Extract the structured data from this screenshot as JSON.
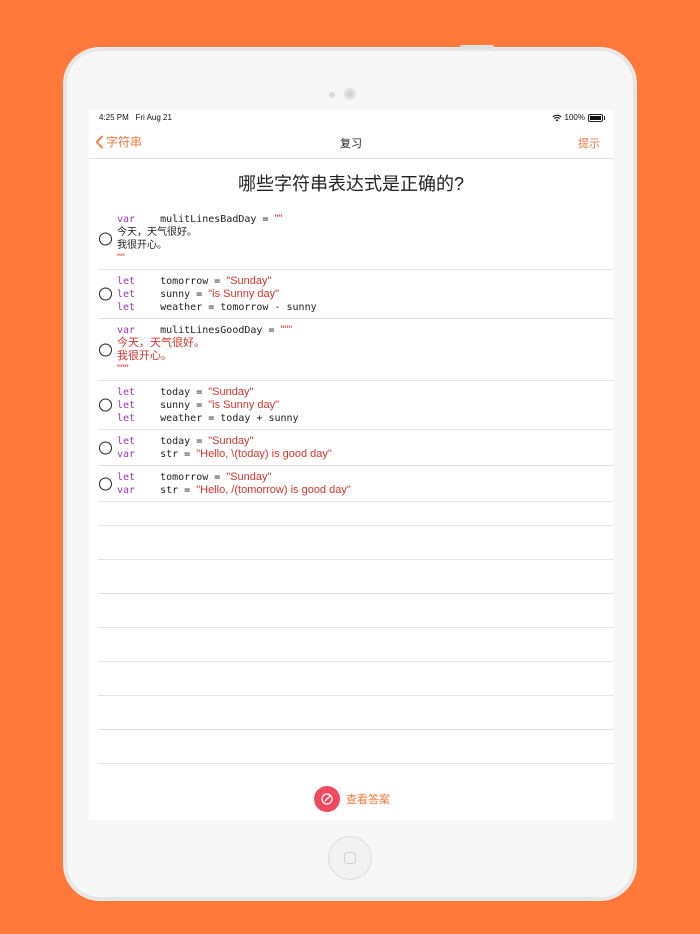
{
  "status": {
    "time": "4:25 PM",
    "date": "Fri Aug 21",
    "battery": "100%"
  },
  "nav": {
    "back_label": "字符串",
    "title": "复习",
    "hint_label": "提示"
  },
  "question": "哪些字符串表达式是正确的?",
  "options": [
    {
      "lines": [
        [
          {
            "t": "var",
            "c": "kw"
          },
          {
            "t": " mulitLinesBadDay = ",
            "c": "code"
          },
          {
            "t": "\"\"",
            "c": "str"
          }
        ],
        [
          {
            "t": "今天，天气很好。",
            "c": "plain-cn"
          }
        ],
        [
          {
            "t": "我很开心。",
            "c": "plain-cn"
          }
        ],
        [
          {
            "t": "\"\"",
            "c": "str"
          }
        ]
      ]
    },
    {
      "lines": [
        [
          {
            "t": "let",
            "c": "kw"
          },
          {
            "t": " tomorrow = ",
            "c": "code"
          },
          {
            "t": "\"Sunday\"",
            "c": "str"
          }
        ],
        [
          {
            "t": "let",
            "c": "kw"
          },
          {
            "t": " sunny = ",
            "c": "code"
          },
          {
            "t": "\"is Sunny day\"",
            "c": "str"
          }
        ],
        [
          {
            "t": "let",
            "c": "kw"
          },
          {
            "t": " weather = tomorrow - sunny",
            "c": "code"
          }
        ]
      ]
    },
    {
      "lines": [
        [
          {
            "t": "var",
            "c": "kw"
          },
          {
            "t": " mulitLinesGoodDay = ",
            "c": "code"
          },
          {
            "t": "\"\"\"",
            "c": "str"
          }
        ],
        [
          {
            "t": "今天，天气很好。",
            "c": "str"
          }
        ],
        [
          {
            "t": "我很开心。",
            "c": "str"
          }
        ],
        [
          {
            "t": "\"\"\"",
            "c": "str"
          }
        ]
      ]
    },
    {
      "lines": [
        [
          {
            "t": "let",
            "c": "kw"
          },
          {
            "t": " today = ",
            "c": "code"
          },
          {
            "t": "\"Sunday\"",
            "c": "str"
          }
        ],
        [
          {
            "t": "let",
            "c": "kw"
          },
          {
            "t": " sunny = ",
            "c": "code"
          },
          {
            "t": "\"is Sunny day\"",
            "c": "str"
          }
        ],
        [
          {
            "t": "let",
            "c": "kw"
          },
          {
            "t": " weather = today + sunny",
            "c": "code"
          }
        ]
      ]
    },
    {
      "lines": [
        [
          {
            "t": "let",
            "c": "kw"
          },
          {
            "t": " today = ",
            "c": "code"
          },
          {
            "t": "\"Sunday\"",
            "c": "str"
          }
        ],
        [
          {
            "t": "var",
            "c": "kw"
          },
          {
            "t": " str = ",
            "c": "code"
          },
          {
            "t": "\"Hello, \\(today) is good day\"",
            "c": "str"
          }
        ]
      ]
    },
    {
      "lines": [
        [
          {
            "t": "let",
            "c": "kw"
          },
          {
            "t": " tomorrow = ",
            "c": "code"
          },
          {
            "t": "\"Sunday\"",
            "c": "str"
          }
        ],
        [
          {
            "t": "var",
            "c": "kw"
          },
          {
            "t": " str = ",
            "c": "code"
          },
          {
            "t": "\"Hello, /(tomorrow) is good day\"",
            "c": "str"
          }
        ]
      ]
    }
  ],
  "answer_button": {
    "label": "查看答案",
    "icon": "edit-icon"
  },
  "colors": {
    "background": "#ff7a3a",
    "accent": "#f07a3c",
    "keyword": "#9b37b6",
    "string": "#d4352c",
    "answer_circle": "#f04a5e"
  }
}
